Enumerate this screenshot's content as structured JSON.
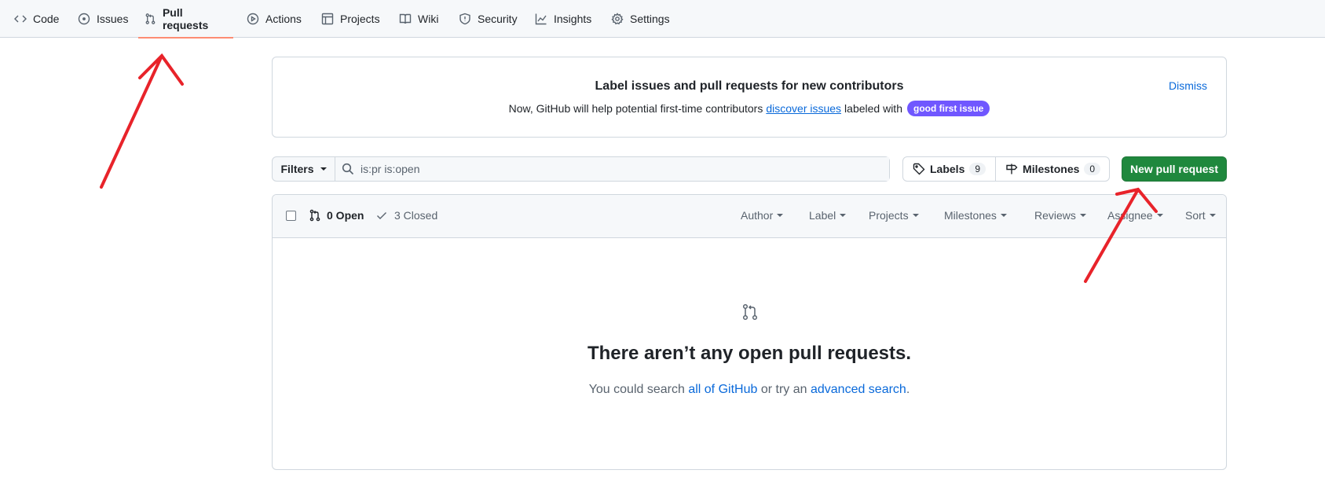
{
  "nav": {
    "items": [
      {
        "label": "Code",
        "icon": "code-icon"
      },
      {
        "label": "Issues",
        "icon": "issue-opened-icon"
      },
      {
        "label": "Pull requests",
        "icon": "git-pull-request-icon"
      },
      {
        "label": "Actions",
        "icon": "play-icon"
      },
      {
        "label": "Projects",
        "icon": "table-icon"
      },
      {
        "label": "Wiki",
        "icon": "book-icon"
      },
      {
        "label": "Security",
        "icon": "shield-icon"
      },
      {
        "label": "Insights",
        "icon": "graph-icon"
      },
      {
        "label": "Settings",
        "icon": "gear-icon"
      }
    ],
    "active": "Pull requests",
    "active_color": "#fd8c73"
  },
  "banner": {
    "title": "Label issues and pull requests for new contributors",
    "desc_before": "Now, GitHub will help potential first-time contributors",
    "desc_link": "discover issues",
    "desc_after": "labeled with",
    "label_badge": "good first issue",
    "label_badge_color": "#7057ff",
    "dismiss": "Dismiss"
  },
  "toolbar": {
    "filters_label": "Filters",
    "search_value": "is:pr is:open",
    "labels_label": "Labels",
    "labels_count": "9",
    "milestones_label": "Milestones",
    "milestones_count": "0",
    "new_pr_label": "New pull request",
    "new_pr_color": "#1f883d"
  },
  "list": {
    "open_label": "0 Open",
    "closed_label": "3 Closed",
    "filters": [
      "Author",
      "Label",
      "Projects",
      "Milestones",
      "Reviews",
      "Assignee",
      "Sort"
    ]
  },
  "blankslate": {
    "title": "There aren’t any open pull requests.",
    "desc_before": "You could search",
    "link1": "all of GitHub",
    "desc_middle": "or try an",
    "link2": "advanced search",
    "desc_after": "."
  },
  "annotation_color": "#e8232a"
}
